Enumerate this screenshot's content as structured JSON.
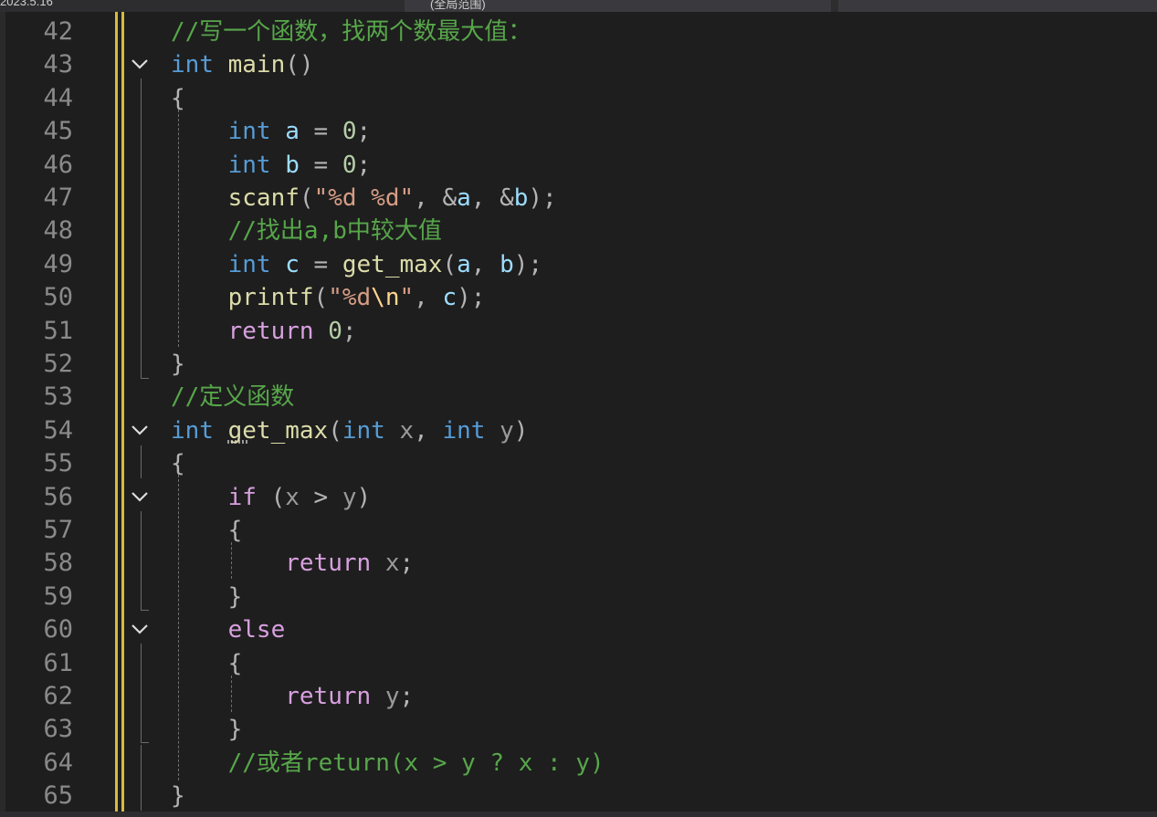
{
  "titlebar": {
    "left_text": "2023.5.16",
    "mid_text": "(全局范围)"
  },
  "editor": {
    "colors": {
      "background": "#1e1e1e",
      "keyword": "#569cd6",
      "function": "#dcdcaa",
      "variable": "#9cdcfe",
      "parameter": "#9a9a9a",
      "string": "#d69d85",
      "number": "#b5cea8",
      "comment": "#57a64a",
      "control": "#d8a0df",
      "change_bar": "#d7ba3d"
    },
    "lines": [
      {
        "num": "42",
        "tokens": [
          {
            "t": "//写一个函数，找两个数最大值：",
            "c": "cm"
          }
        ]
      },
      {
        "num": "43",
        "fold": true,
        "tokens": [
          {
            "t": "int",
            "c": "kw"
          },
          {
            "t": " "
          },
          {
            "t": "main",
            "c": "fn"
          },
          {
            "t": "()",
            "c": "pn"
          }
        ]
      },
      {
        "num": "44",
        "tokens": [
          {
            "t": "{",
            "c": "pn"
          }
        ]
      },
      {
        "num": "45",
        "tokens": [
          {
            "t": "    "
          },
          {
            "t": "int",
            "c": "kw"
          },
          {
            "t": " "
          },
          {
            "t": "a",
            "c": "var"
          },
          {
            "t": " = ",
            "c": "pn"
          },
          {
            "t": "0",
            "c": "num"
          },
          {
            "t": ";",
            "c": "pn"
          }
        ]
      },
      {
        "num": "46",
        "tokens": [
          {
            "t": "    "
          },
          {
            "t": "int",
            "c": "kw"
          },
          {
            "t": " "
          },
          {
            "t": "b",
            "c": "var"
          },
          {
            "t": " = ",
            "c": "pn"
          },
          {
            "t": "0",
            "c": "num"
          },
          {
            "t": ";",
            "c": "pn"
          }
        ]
      },
      {
        "num": "47",
        "tokens": [
          {
            "t": "    "
          },
          {
            "t": "scanf",
            "c": "fn"
          },
          {
            "t": "(",
            "c": "pn"
          },
          {
            "t": "\"%d %d\"",
            "c": "str"
          },
          {
            "t": ", &",
            "c": "pn"
          },
          {
            "t": "a",
            "c": "var"
          },
          {
            "t": ", &",
            "c": "pn"
          },
          {
            "t": "b",
            "c": "var"
          },
          {
            "t": ");",
            "c": "pn"
          }
        ]
      },
      {
        "num": "48",
        "tokens": [
          {
            "t": "    "
          },
          {
            "t": "//找出a,b中较大值",
            "c": "cm"
          }
        ]
      },
      {
        "num": "49",
        "tokens": [
          {
            "t": "    "
          },
          {
            "t": "int",
            "c": "kw"
          },
          {
            "t": " "
          },
          {
            "t": "c",
            "c": "var"
          },
          {
            "t": " = ",
            "c": "pn"
          },
          {
            "t": "get_max",
            "c": "fn"
          },
          {
            "t": "(",
            "c": "pn"
          },
          {
            "t": "a",
            "c": "var"
          },
          {
            "t": ", ",
            "c": "pn"
          },
          {
            "t": "b",
            "c": "var"
          },
          {
            "t": ");",
            "c": "pn"
          }
        ]
      },
      {
        "num": "50",
        "tokens": [
          {
            "t": "    "
          },
          {
            "t": "printf",
            "c": "fn"
          },
          {
            "t": "(",
            "c": "pn"
          },
          {
            "t": "\"%d",
            "c": "str"
          },
          {
            "t": "\\n",
            "c": "esc"
          },
          {
            "t": "\"",
            "c": "str"
          },
          {
            "t": ", ",
            "c": "pn"
          },
          {
            "t": "c",
            "c": "var"
          },
          {
            "t": ");",
            "c": "pn"
          }
        ]
      },
      {
        "num": "51",
        "tokens": [
          {
            "t": "    "
          },
          {
            "t": "return",
            "c": "ctl"
          },
          {
            "t": " "
          },
          {
            "t": "0",
            "c": "num"
          },
          {
            "t": ";",
            "c": "pn"
          }
        ]
      },
      {
        "num": "52",
        "tokens": [
          {
            "t": "}",
            "c": "pn"
          }
        ]
      },
      {
        "num": "53",
        "tokens": [
          {
            "t": "//定义函数",
            "c": "cm"
          }
        ]
      },
      {
        "num": "54",
        "fold": true,
        "tokens": [
          {
            "t": "int",
            "c": "kw"
          },
          {
            "t": " "
          },
          {
            "t": "get_max",
            "c": "fn"
          },
          {
            "t": "(",
            "c": "pn"
          },
          {
            "t": "int",
            "c": "kw"
          },
          {
            "t": " "
          },
          {
            "t": "x",
            "c": "par"
          },
          {
            "t": ", ",
            "c": "pn"
          },
          {
            "t": "int",
            "c": "kw"
          },
          {
            "t": " "
          },
          {
            "t": "y",
            "c": "par"
          },
          {
            "t": ")",
            "c": "pn"
          }
        ]
      },
      {
        "num": "55",
        "tokens": [
          {
            "t": "{",
            "c": "pn"
          }
        ]
      },
      {
        "num": "56",
        "fold": true,
        "tokens": [
          {
            "t": "    "
          },
          {
            "t": "if",
            "c": "ctl"
          },
          {
            "t": " (",
            "c": "pn"
          },
          {
            "t": "x",
            "c": "par"
          },
          {
            "t": " > ",
            "c": "pn"
          },
          {
            "t": "y",
            "c": "par"
          },
          {
            "t": ")",
            "c": "pn"
          }
        ]
      },
      {
        "num": "57",
        "tokens": [
          {
            "t": "    "
          },
          {
            "t": "{",
            "c": "pn"
          }
        ]
      },
      {
        "num": "58",
        "tokens": [
          {
            "t": "        "
          },
          {
            "t": "return",
            "c": "ctl"
          },
          {
            "t": " "
          },
          {
            "t": "x",
            "c": "par"
          },
          {
            "t": ";",
            "c": "pn"
          }
        ]
      },
      {
        "num": "59",
        "tokens": [
          {
            "t": "    "
          },
          {
            "t": "}",
            "c": "pn"
          }
        ]
      },
      {
        "num": "60",
        "fold": true,
        "tokens": [
          {
            "t": "    "
          },
          {
            "t": "else",
            "c": "ctl"
          }
        ]
      },
      {
        "num": "61",
        "tokens": [
          {
            "t": "    "
          },
          {
            "t": "{",
            "c": "pn"
          }
        ]
      },
      {
        "num": "62",
        "tokens": [
          {
            "t": "        "
          },
          {
            "t": "return",
            "c": "ctl"
          },
          {
            "t": " "
          },
          {
            "t": "y",
            "c": "par"
          },
          {
            "t": ";",
            "c": "pn"
          }
        ]
      },
      {
        "num": "63",
        "tokens": [
          {
            "t": "    "
          },
          {
            "t": "}",
            "c": "pn"
          }
        ]
      },
      {
        "num": "64",
        "tokens": [
          {
            "t": "    "
          },
          {
            "t": "//或者return(x > y ? x : y)",
            "c": "cm"
          }
        ]
      },
      {
        "num": "65",
        "tokens": [
          {
            "t": "}",
            "c": "pn"
          }
        ]
      }
    ]
  }
}
